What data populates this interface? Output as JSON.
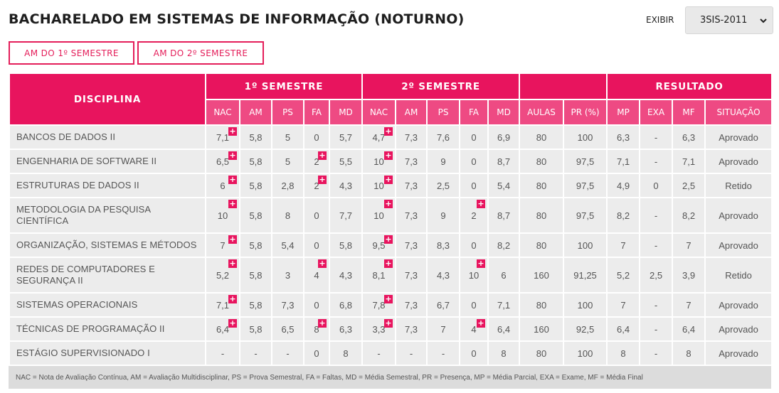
{
  "header": {
    "title": "BACHARELADO EM SISTEMAS DE INFORMAÇÃO (NOTURNO)",
    "exibir_label": "EXIBIR",
    "select_value": "3SIS-2011"
  },
  "buttons": {
    "sem1": "AM DO 1º SEMESTRE",
    "sem2": "AM DO 2º SEMESTRE"
  },
  "table": {
    "group_headers": {
      "disciplina": "DISCIPLINA",
      "sem1": "1º SEMESTRE",
      "sem2": "2º SEMESTRE",
      "resultado": "RESULTADO"
    },
    "columns": [
      "NAC",
      "AM",
      "PS",
      "FA",
      "MD",
      "NAC",
      "AM",
      "PS",
      "FA",
      "MD",
      "AULAS",
      "PR (%)",
      "MP",
      "EXA",
      "MF",
      "SITUAÇÃO"
    ],
    "rows": [
      {
        "disc": "BANCOS DE DADOS II",
        "cells": [
          "7,1",
          "5,8",
          "5",
          "0",
          "5,7",
          "4,7",
          "7,3",
          "7,6",
          "0",
          "6,9",
          "80",
          "100",
          "6,3",
          "-",
          "6,3",
          "Aprovado"
        ]
      },
      {
        "disc": "ENGENHARIA DE SOFTWARE II",
        "cells": [
          "6,5",
          "5,8",
          "5",
          "2",
          "5,5",
          "10",
          "7,3",
          "9",
          "0",
          "8,7",
          "80",
          "97,5",
          "7,1",
          "-",
          "7,1",
          "Aprovado"
        ]
      },
      {
        "disc": "ESTRUTURAS DE DADOS II",
        "cells": [
          "6",
          "5,8",
          "2,8",
          "2",
          "4,3",
          "10",
          "7,3",
          "2,5",
          "0",
          "5,4",
          "80",
          "97,5",
          "4,9",
          "0",
          "2,5",
          "Retido"
        ]
      },
      {
        "disc": "METODOLOGIA DA PESQUISA CIENTÍFICA",
        "cells": [
          "10",
          "5,8",
          "8",
          "0",
          "7,7",
          "10",
          "7,3",
          "9",
          "2",
          "8,7",
          "80",
          "97,5",
          "8,2",
          "-",
          "8,2",
          "Aprovado"
        ]
      },
      {
        "disc": "ORGANIZAÇÃO, SISTEMAS E MÉTODOS",
        "cells": [
          "7",
          "5,8",
          "5,4",
          "0",
          "5,8",
          "9,5",
          "7,3",
          "8,3",
          "0",
          "8,2",
          "80",
          "100",
          "7",
          "-",
          "7",
          "Aprovado"
        ]
      },
      {
        "disc": "REDES DE COMPUTADORES E SEGURANÇA II",
        "cells": [
          "5,2",
          "5,8",
          "3",
          "4",
          "4,3",
          "8,1",
          "7,3",
          "4,3",
          "10",
          "6",
          "160",
          "91,25",
          "5,2",
          "2,5",
          "3,9",
          "Retido"
        ]
      },
      {
        "disc": "SISTEMAS OPERACIONAIS",
        "cells": [
          "7,1",
          "5,8",
          "7,3",
          "0",
          "6,8",
          "7,8",
          "7,3",
          "6,7",
          "0",
          "7,1",
          "80",
          "100",
          "7",
          "-",
          "7",
          "Aprovado"
        ]
      },
      {
        "disc": "TÉCNICAS DE PROGRAMAÇÃO II",
        "cells": [
          "6,4",
          "5,8",
          "6,5",
          "8",
          "6,3",
          "3,3",
          "7,3",
          "7",
          "4",
          "6,4",
          "160",
          "92,5",
          "6,4",
          "-",
          "6,4",
          "Aprovado"
        ]
      },
      {
        "disc": "ESTÁGIO SUPERVISIONADO I",
        "cells": [
          "-",
          "-",
          "-",
          "0",
          "8",
          "-",
          "-",
          "-",
          "0",
          "8",
          "80",
          "100",
          "8",
          "-",
          "8",
          "Aprovado"
        ]
      }
    ],
    "plus_symbol": "+"
  },
  "legend": "NAC = Nota de Avaliação Contínua, AM = Avaliação Multidisciplinar, PS = Prova Semestral, FA = Faltas, MD = Média Semestral, PR = Presença, MP = Média Parcial, EXA = Exame, MF = Média Final",
  "colors": {
    "accent": "#e8145e",
    "header_light": "#ee4a83",
    "row_bg": "#ececec"
  }
}
